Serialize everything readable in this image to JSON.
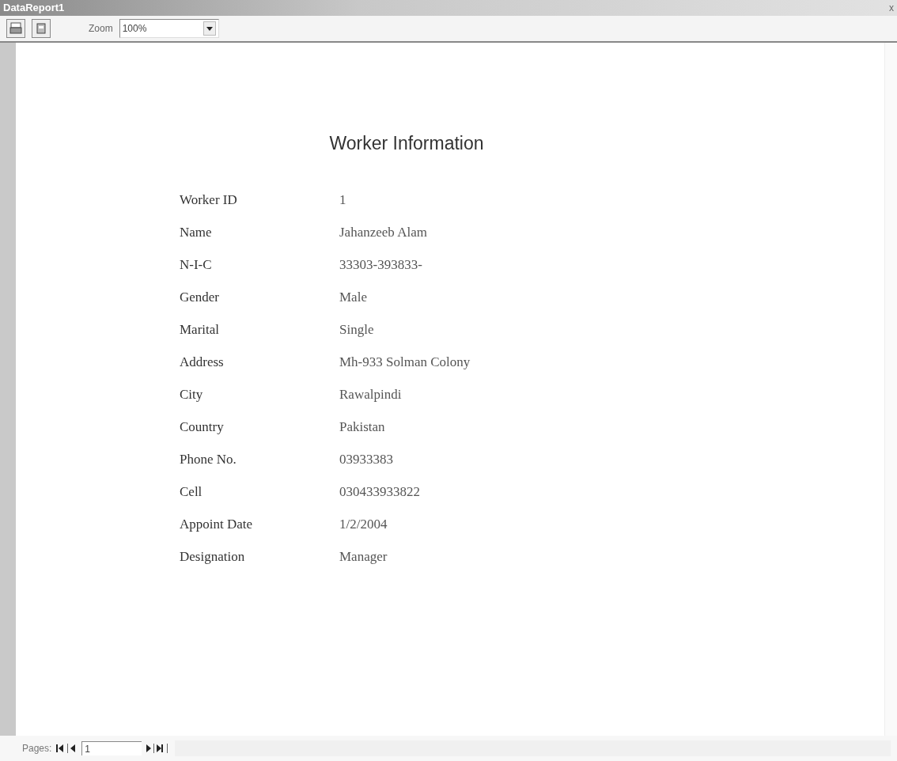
{
  "window": {
    "title": "DataReport1",
    "close": "x"
  },
  "toolbar": {
    "zoom_label": "Zoom",
    "zoom_value": "100%"
  },
  "report": {
    "title": "Worker Information",
    "fields": [
      {
        "label": "Worker ID",
        "value": "1"
      },
      {
        "label": "Name",
        "value": "Jahanzeeb Alam"
      },
      {
        "label": "N-I-C",
        "value": "33303-393833-"
      },
      {
        "label": "Gender",
        "value": "Male"
      },
      {
        "label": "Marital",
        "value": "Single"
      },
      {
        "label": "Address",
        "value": "Mh-933 Solman Colony"
      },
      {
        "label": "City",
        "value": "Rawalpindi"
      },
      {
        "label": "Country",
        "value": "Pakistan"
      },
      {
        "label": "Phone No.",
        "value": "03933383"
      },
      {
        "label": "Cell",
        "value": "030433933822"
      },
      {
        "label": "Appoint Date",
        "value": "1/2/2004"
      },
      {
        "label": "Designation",
        "value": "Manager"
      }
    ]
  },
  "pager": {
    "label": "Pages:",
    "page": "1"
  }
}
